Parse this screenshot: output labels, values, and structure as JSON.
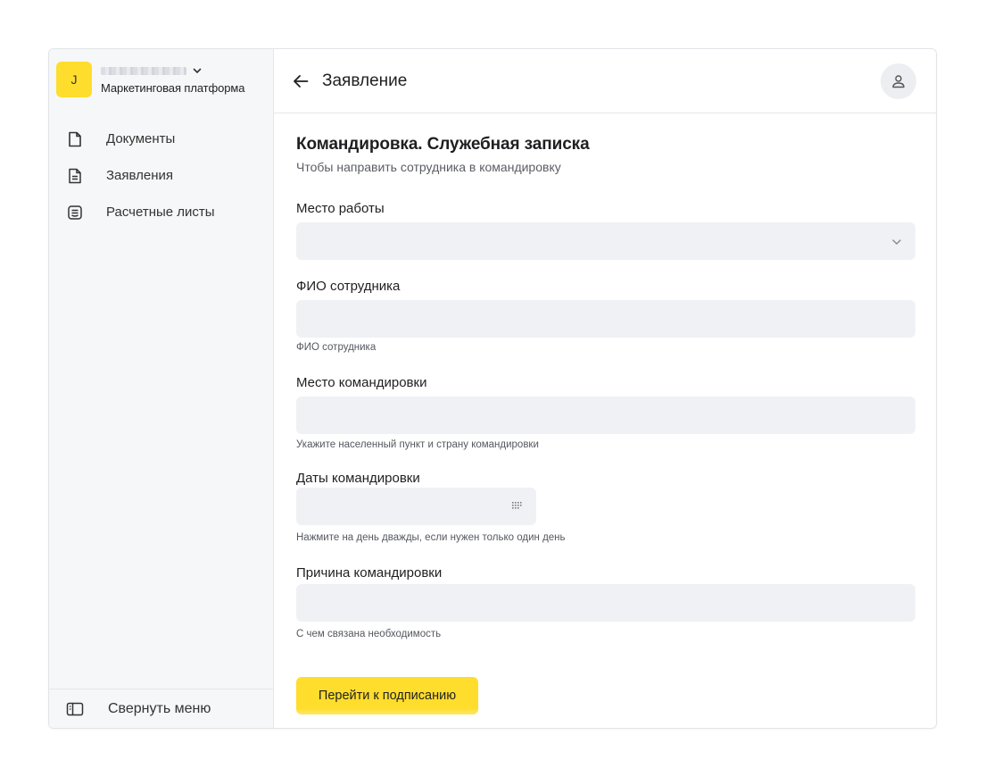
{
  "sidebar": {
    "org_avatar_letter": "J",
    "org_subtitle": "Маркетинговая платформа",
    "items": [
      {
        "label": "Документы",
        "icon": "document-icon"
      },
      {
        "label": "Заявления",
        "icon": "statement-icon"
      },
      {
        "label": "Расчетные листы",
        "icon": "payslip-icon"
      }
    ],
    "collapse_label": "Свернуть меню"
  },
  "header": {
    "title": "Заявление"
  },
  "form": {
    "title": "Командировка. Служебная записка",
    "subtitle": "Чтобы направить сотрудника в командировку",
    "fields": [
      {
        "label": "Место работы",
        "value": "",
        "hint": ""
      },
      {
        "label": "ФИО сотрудника",
        "value": "",
        "hint": "ФИО сотрудника"
      },
      {
        "label": "Место командировки",
        "value": "",
        "hint": "Укажите населенный пункт и страну командировки"
      },
      {
        "label": "Даты командировки",
        "value": "",
        "hint": "Нажмите на день дважды, если нужен только один день"
      },
      {
        "label": "Причина командировки",
        "value": "",
        "hint": "С чем связана необходимость"
      }
    ],
    "submit_label": "Перейти к подписанию"
  },
  "colors": {
    "accent": "#ffdd2d",
    "input_bg": "#f0f1f4",
    "sidebar_bg": "#f6f7f8"
  }
}
